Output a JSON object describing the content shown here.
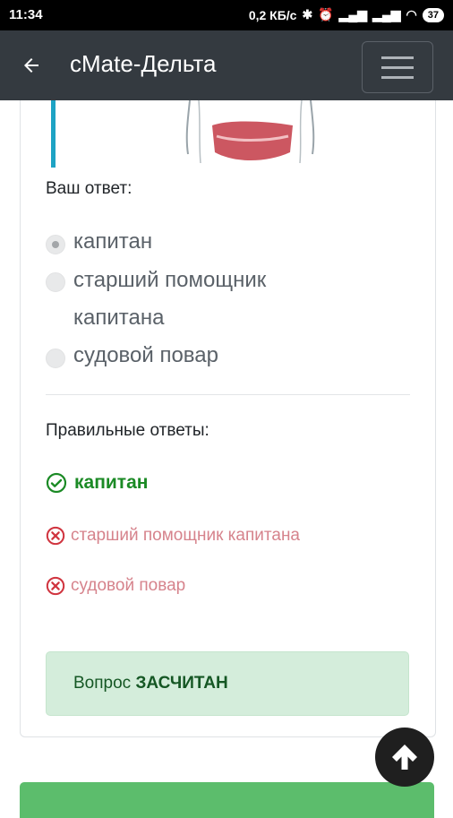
{
  "status_bar": {
    "time": "11:34",
    "network_speed": "0,2 КБ/с",
    "battery": "37"
  },
  "app_bar": {
    "title": "cMate-Дельта",
    "back_icon": "arrow-left-icon",
    "menu_icon": "hamburger-icon"
  },
  "question": {
    "your_answer_label": "Ваш ответ:",
    "options": [
      {
        "label": "капитан",
        "selected": true
      },
      {
        "label": "старший помощник",
        "label_line2": "капитана",
        "selected": false
      },
      {
        "label": "судовой повар",
        "selected": false
      }
    ]
  },
  "correct": {
    "title": "Правильные ответы:",
    "answers": [
      {
        "label": "капитан",
        "status": "correct"
      },
      {
        "label": "старший помощник капитана",
        "status": "wrong"
      },
      {
        "label": "судовой повар",
        "status": "wrong"
      }
    ]
  },
  "result": {
    "prefix": "Вопрос",
    "status": "ЗАСЧИТАН"
  },
  "colors": {
    "app_bar": "#343a40",
    "correct_green": "#1b8a25",
    "wrong_red": "#d6838c",
    "result_bg": "#d4eddb"
  }
}
